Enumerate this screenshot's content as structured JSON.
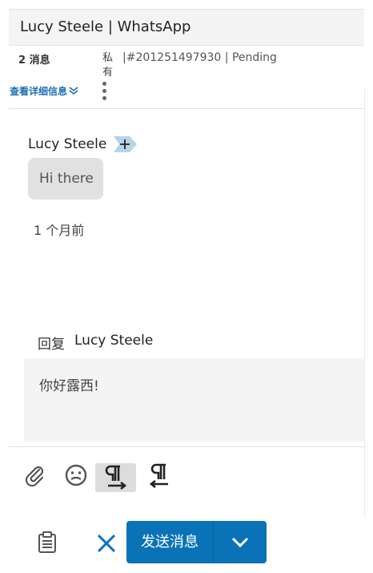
{
  "header": {
    "title": "Lucy Steele | WhatsApp"
  },
  "meta": {
    "message_count": "2 消息",
    "visibility": "私有",
    "ticket": "|#201251497930  |  Pending",
    "details_link": "查看详细信息"
  },
  "conversation": {
    "sender": "Lucy Steele",
    "message": "Hi there",
    "timestamp": "1 个月前"
  },
  "reply": {
    "label": "回复",
    "recipient": "Lucy Steele",
    "text": "你好露西!"
  },
  "toolbar": {
    "icons": [
      "paperclip-icon",
      "emoji-icon",
      "text-direction-ltr-icon",
      "text-direction-rtl-icon"
    ]
  },
  "actions": {
    "send_label": "发送消息",
    "icons": [
      "clipboard-icon",
      "close-icon",
      "chevron-down-icon"
    ]
  },
  "colors": {
    "accent": "#0a73b7",
    "link": "#1f6fb2",
    "bubble": "#e1e1e1",
    "tag": "#b7d3e8"
  }
}
